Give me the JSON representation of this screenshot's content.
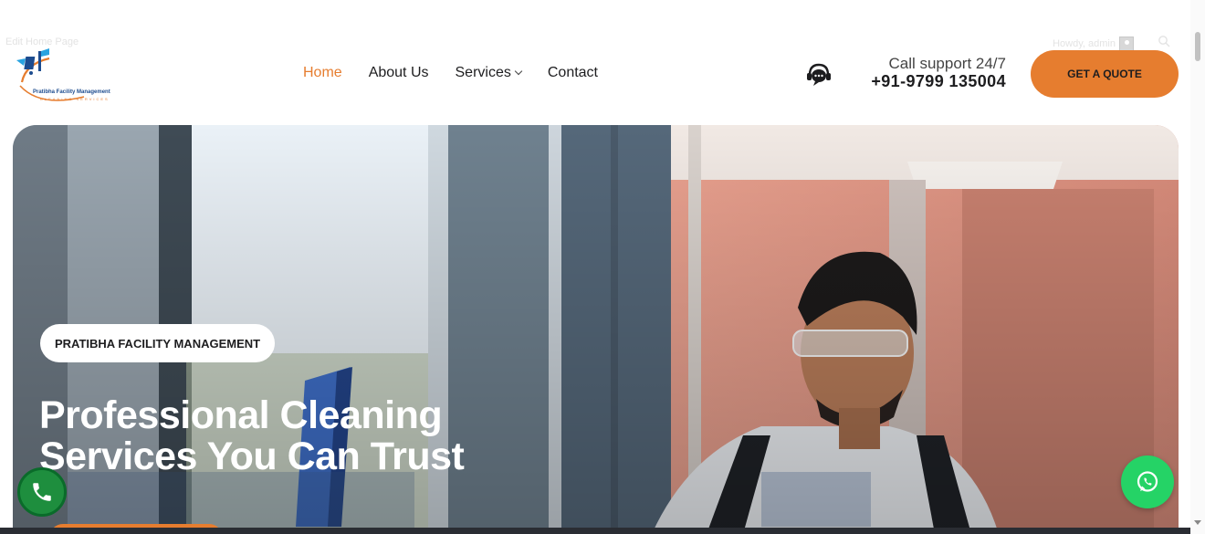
{
  "admin_bar": {
    "edit_label": "Edit Home Page",
    "howdy_label": "Howdy, admin",
    "icons": [
      "avatar-icon",
      "search-icon"
    ]
  },
  "brand": {
    "name": "Pratibha Facility Management",
    "tagline": "CLEANING SERVICES",
    "colors": {
      "accent": "#e67d2f",
      "navy": "#1d4c8f"
    }
  },
  "nav": {
    "items": [
      {
        "label": "Home",
        "active": true
      },
      {
        "label": "About Us",
        "active": false
      },
      {
        "label": "Services",
        "active": false,
        "has_dropdown": true
      },
      {
        "label": "Contact",
        "active": false
      }
    ]
  },
  "support": {
    "icon": "support-chat-icon",
    "line1": "Call support 24/7",
    "phone": "+91-9799 135004"
  },
  "cta": {
    "label": "GET A QUOTE",
    "color": "#e67d2f"
  },
  "hero": {
    "badge": "PRATIBHA FACILITY MANAGEMENT",
    "headline_line1": "Professional Cleaning",
    "headline_line2": "Services You Can Trust"
  },
  "floating": {
    "call_icon": "phone-icon",
    "whatsapp_icon": "whatsapp-icon",
    "call_color": "#1e8e3e",
    "whatsapp_color": "#25d366"
  }
}
